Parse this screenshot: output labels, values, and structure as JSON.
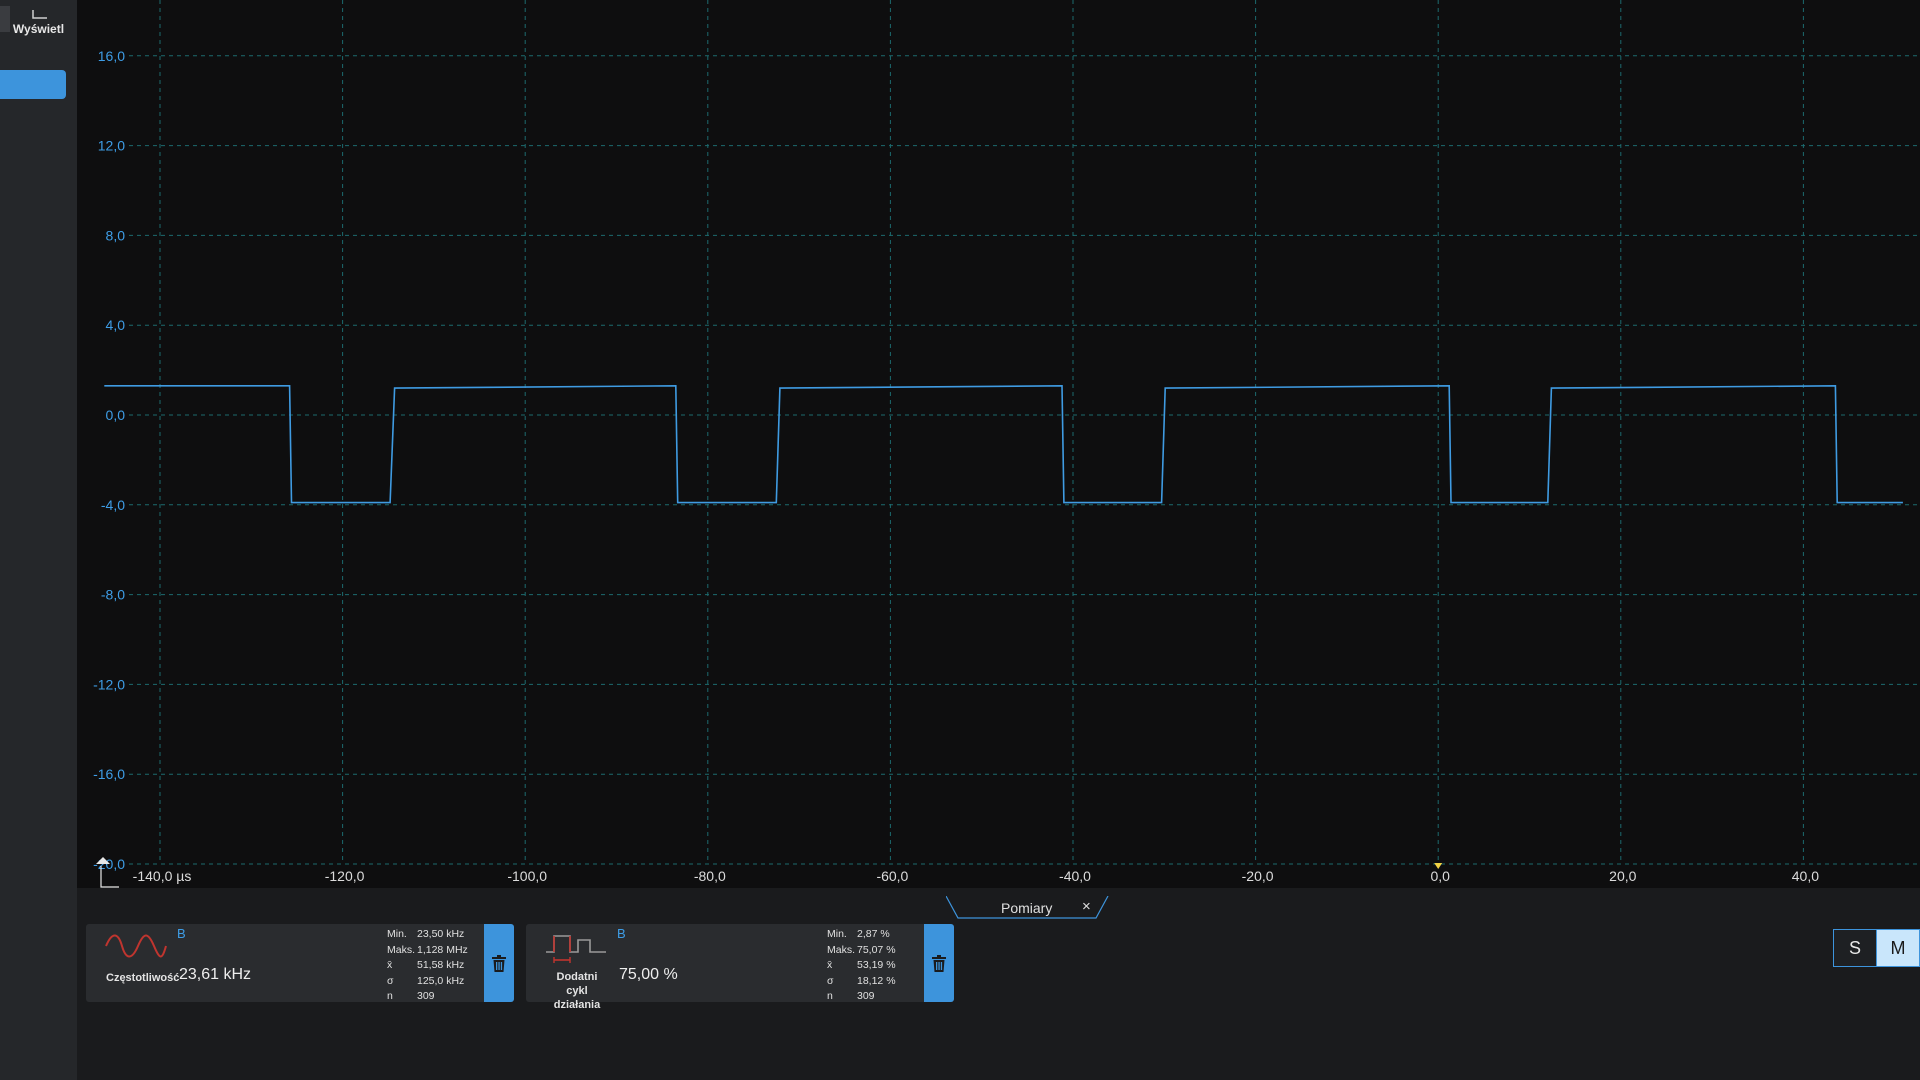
{
  "sidebar": {
    "display_label": "Wyświetl"
  },
  "chart_data": {
    "type": "line",
    "x_unit": "µs",
    "xlim": [
      -150,
      50
    ],
    "ylim": [
      -20,
      18
    ],
    "y_ticks": [
      "16,0",
      "12,0",
      "8,0",
      "4,0",
      "0,0",
      "-4,0",
      "-8,0",
      "-12,0",
      "-16,0",
      "-20,0"
    ],
    "x_ticks": [
      "-140,0 µs",
      "-120,0",
      "-100,0",
      "-80,0",
      "-60,0",
      "-40,0",
      "-20,0",
      "0,0",
      "20,0",
      "40,0"
    ],
    "series": [
      {
        "channel": "B",
        "color": "#3f9be2",
        "high": 1.3,
        "low": -3.9,
        "x": [
          -146.1,
          -125.8,
          -125.6,
          -114.8,
          -114.3,
          -83.5,
          -83.3,
          -72.5,
          -72.1,
          -41.2,
          -41.0,
          -30.3,
          -29.9,
          1.2,
          1.4,
          12.0,
          12.4,
          43.5,
          43.7,
          50.9
        ],
        "y": [
          1.3,
          1.3,
          -3.9,
          -3.9,
          1.2,
          1.3,
          -3.9,
          -3.9,
          1.2,
          1.3,
          -3.9,
          -3.9,
          1.2,
          1.3,
          -3.9,
          -3.9,
          1.2,
          1.3,
          -3.9,
          -3.9
        ]
      }
    ],
    "trigger_x": 0
  },
  "measurements_tab": {
    "label": "Pomiary",
    "close_symbol": "×"
  },
  "measurements": [
    {
      "channel": "B",
      "name": "Częstotliwość",
      "value": "23,61 kHz",
      "icon": "sine-wave-icon",
      "stats": [
        {
          "key": "Min.",
          "value": "23,50 kHz"
        },
        {
          "key": "Maks.",
          "value": "1,128 MHz"
        },
        {
          "key": "x̄",
          "value": "51,58 kHz"
        },
        {
          "key": "σ",
          "value": "125,0 kHz"
        },
        {
          "key": "n",
          "value": "309"
        }
      ]
    },
    {
      "channel": "B",
      "name": "Dodatni cykl działania",
      "name_line1": "Dodatni cykl",
      "name_line2": "działania",
      "value": "75,00 %",
      "icon": "pulse-duty-icon",
      "stats": [
        {
          "key": "Min.",
          "value": "2,87 %"
        },
        {
          "key": "Maks.",
          "value": "75,07 %"
        },
        {
          "key": "x̄",
          "value": "53,19 %"
        },
        {
          "key": "σ",
          "value": "18,12 %"
        },
        {
          "key": "n",
          "value": "309"
        }
      ]
    }
  ],
  "mode_toggle": {
    "s_label": "S",
    "m_label": "M",
    "selected": "M"
  }
}
